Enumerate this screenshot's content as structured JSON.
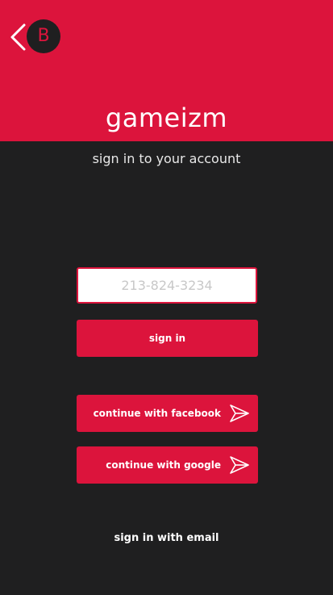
{
  "header": {
    "avatar_letter": "B",
    "title": "gameizm",
    "back_icon": "chevron-left-icon"
  },
  "subtitle": "sign in to your account",
  "phone": {
    "value": "",
    "placeholder": "213-824-3234"
  },
  "buttons": {
    "sign_in": "sign in",
    "facebook": "continue with facebook",
    "google": "continue with google",
    "arrow_icon": "send-arrow-icon"
  },
  "email_link": "sign in with email",
  "colors": {
    "accent": "#dc143c",
    "background": "#1f1f20",
    "text": "#ffffff",
    "placeholder": "#c8c8c8"
  }
}
